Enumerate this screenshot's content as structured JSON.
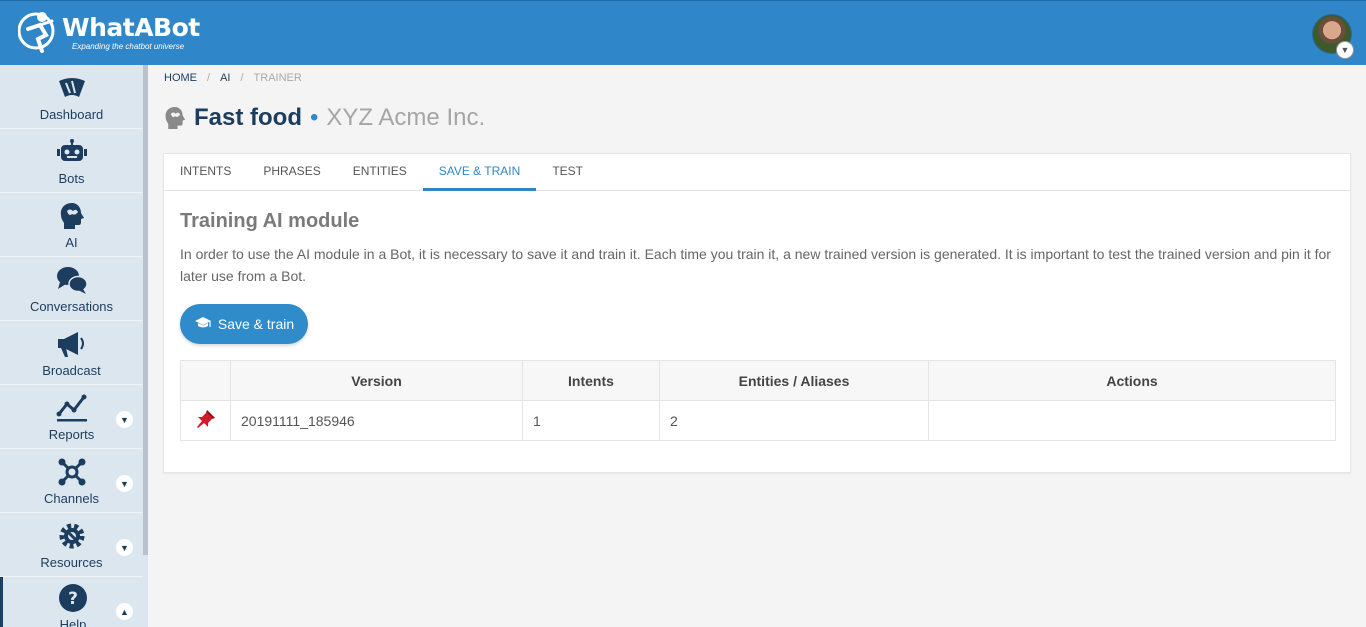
{
  "header": {
    "logo_title": "WhatABot",
    "logo_subtitle": "Expanding the chatbot universe",
    "colors": {
      "primary": "#2f86c8",
      "sidebar": "#dce6ef",
      "dark": "#1c3d5e"
    }
  },
  "sidebar": {
    "items": [
      {
        "label": "Dashboard",
        "icon": "dashboard-icon"
      },
      {
        "label": "Bots",
        "icon": "robot-icon"
      },
      {
        "label": "AI",
        "icon": "brain-head-icon"
      },
      {
        "label": "Conversations",
        "icon": "chat-bubbles-icon"
      },
      {
        "label": "Broadcast",
        "icon": "megaphone-icon"
      },
      {
        "label": "Reports",
        "icon": "line-chart-icon"
      },
      {
        "label": "Channels",
        "icon": "network-icon"
      },
      {
        "label": "Resources",
        "icon": "gear-wrench-icon"
      },
      {
        "label": "Help",
        "icon": "question-circle-icon"
      }
    ]
  },
  "breadcrumb": {
    "home": "HOME",
    "ai": "AI",
    "current": "TRAINER"
  },
  "page": {
    "title": "Fast food",
    "subtitle": "XYZ Acme Inc."
  },
  "tabs": [
    {
      "label": "INTENTS"
    },
    {
      "label": "PHRASES"
    },
    {
      "label": "ENTITIES"
    },
    {
      "label": "SAVE & TRAIN"
    },
    {
      "label": "TEST"
    }
  ],
  "section": {
    "title": "Training AI module",
    "description": "In order to use the AI module in a Bot, it is necessary to save it and train it. Each time you train it, a new trained version is generated. It is important to test the trained version and pin it for later use from a Bot.",
    "button_label": "Save & train"
  },
  "table": {
    "headers": [
      "",
      "Version",
      "Intents",
      "Entities / Aliases",
      "Actions"
    ],
    "rows": [
      {
        "version": "20191111_185946",
        "intents": "1",
        "entities": "2",
        "actions": ""
      }
    ]
  }
}
